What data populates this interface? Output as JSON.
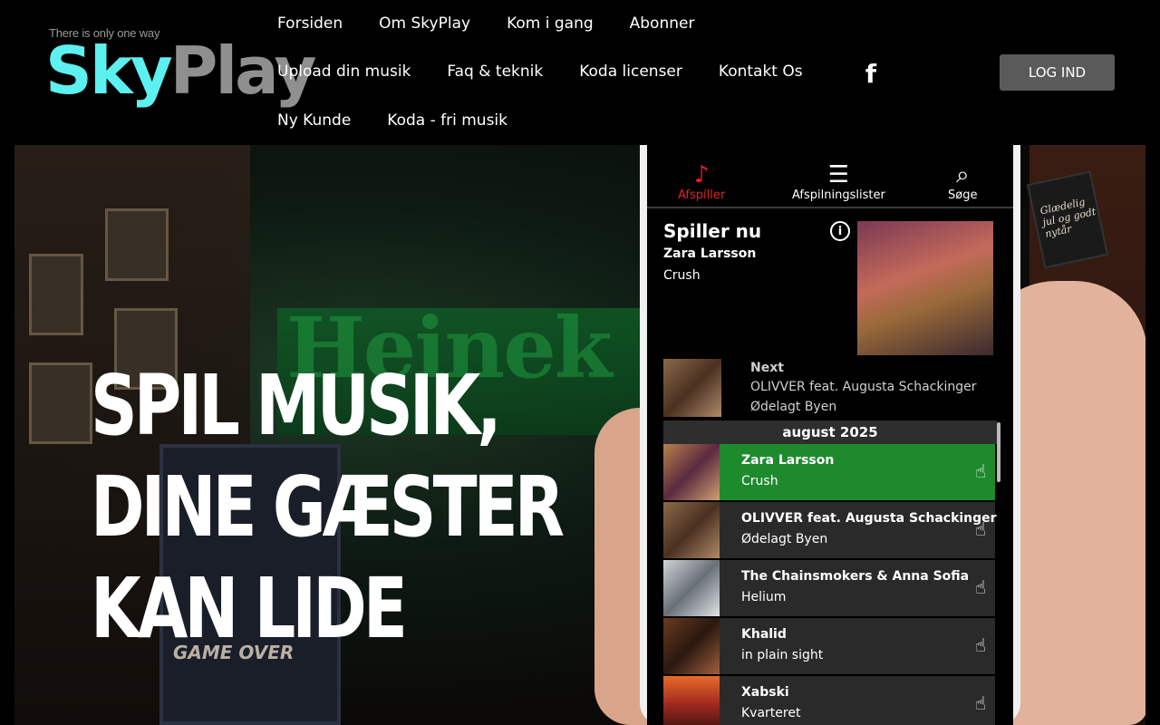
{
  "header": {
    "tagline": "There is only one way",
    "logo": {
      "part1": "Sky",
      "part2": "Play"
    },
    "nav": {
      "row1": [
        "Forsiden",
        "Om SkyPlay",
        "Kom i gang",
        "Abonner"
      ],
      "row2": [
        "Upload din musik",
        "Faq & teknik",
        "Koda licenser",
        "Kontakt Os"
      ],
      "row3": [
        "Ny Kunde",
        "Koda - fri musik"
      ]
    },
    "facebook_icon": "f",
    "login_label": "LOG IND"
  },
  "hero": {
    "headline": [
      "SPIL MUSIK,",
      "DINE GÆSTER",
      "KAN LIDE"
    ],
    "neon_text": "Heinek",
    "game_over": "GAME OVER",
    "sign_text": "Glædelig jul og godt nytår"
  },
  "app": {
    "tabs": [
      {
        "icon": "♪",
        "label": "Afspiller"
      },
      {
        "icon": "☰",
        "label": "Afspilningslister"
      },
      {
        "icon": "⌕",
        "label": "Søge"
      }
    ],
    "now_playing": {
      "title": "Spiller nu",
      "artist": "Zara Larsson",
      "song": "Crush",
      "info_icon": "i"
    },
    "next": {
      "label": "Next",
      "artist": "OLIVVER feat. Augusta Schackinger",
      "song": "Ødelagt Byen"
    },
    "month": "august 2025",
    "tracks": [
      {
        "artist": "Zara Larsson",
        "song": "Crush",
        "active": true
      },
      {
        "artist": "OLIVVER feat. Augusta Schackinger",
        "song": "Ødelagt Byen",
        "active": false
      },
      {
        "artist": "The Chainsmokers & Anna Sofia",
        "song": "Helium",
        "active": false
      },
      {
        "artist": "Khalid",
        "song": "in plain sight",
        "active": false
      },
      {
        "artist": "Xabski",
        "song": "Kvarteret",
        "active": false
      }
    ],
    "tap_icon": "☝"
  },
  "colors": {
    "logo_sky": "#5cf0f0",
    "logo_play": "#8f8f8f",
    "login_bg": "#5a5a5a",
    "active_track": "#1e8a2e",
    "active_tab": "#e0212a"
  }
}
